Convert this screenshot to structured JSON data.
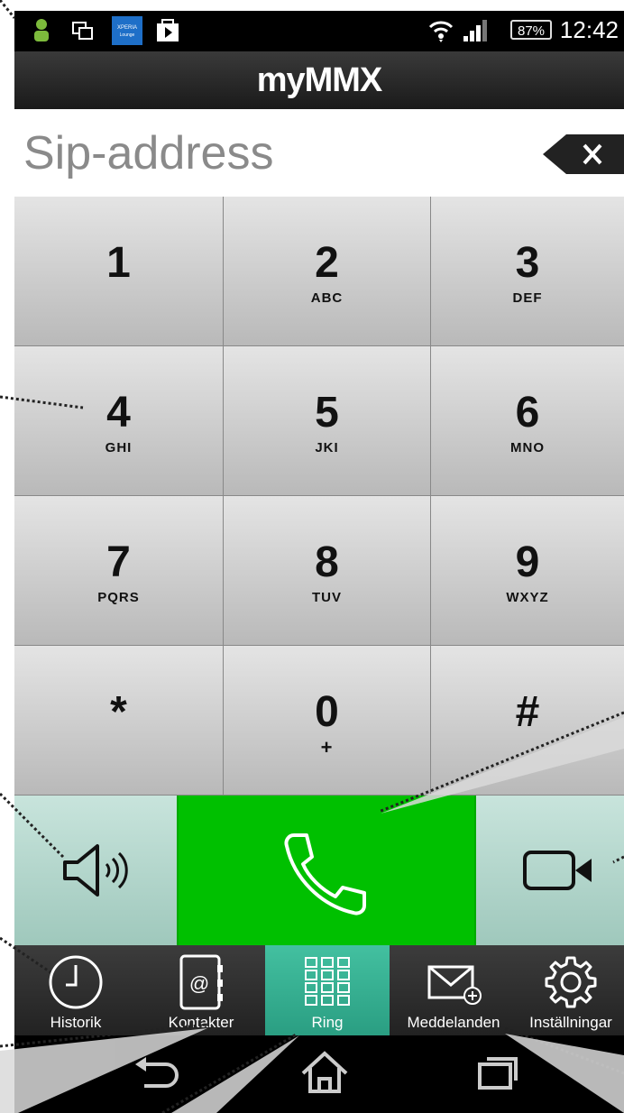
{
  "status_bar": {
    "battery": "87%",
    "time": "12:42",
    "icons": [
      "user-icon",
      "screen-icon",
      "xperia-lounge-icon",
      "store-icon",
      "wifi-icon",
      "signal-icon"
    ]
  },
  "header": {
    "title": "myMMX"
  },
  "sip": {
    "placeholder": "Sip-address",
    "value": ""
  },
  "keypad": [
    {
      "digit": "1",
      "letters": ""
    },
    {
      "digit": "2",
      "letters": "ABC"
    },
    {
      "digit": "3",
      "letters": "DEF"
    },
    {
      "digit": "4",
      "letters": "GHI"
    },
    {
      "digit": "5",
      "letters": "JKI"
    },
    {
      "digit": "6",
      "letters": "MNO"
    },
    {
      "digit": "7",
      "letters": "PQRS"
    },
    {
      "digit": "8",
      "letters": "TUV"
    },
    {
      "digit": "9",
      "letters": "WXYZ"
    },
    {
      "digit": "*",
      "letters": ""
    },
    {
      "digit": "0",
      "letters": "+"
    },
    {
      "digit": "#",
      "letters": ""
    }
  ],
  "call_row": {
    "icons": [
      "speaker-icon",
      "phone-icon",
      "video-camera-icon"
    ],
    "call_color": "#00c000"
  },
  "tabs": [
    {
      "label": "Historik",
      "icon": "clock-icon"
    },
    {
      "label": "Kontakter",
      "icon": "address-book-icon"
    },
    {
      "label": "Ring",
      "icon": "dialpad-icon",
      "active": true
    },
    {
      "label": "Meddelanden",
      "icon": "envelope-icon"
    },
    {
      "label": "Inställningar",
      "icon": "gear-icon"
    }
  ],
  "nav": {
    "icons": [
      "back-icon",
      "home-icon",
      "recents-icon"
    ]
  },
  "colors": {
    "accent": "#2fae8c",
    "call": "#00c000"
  }
}
